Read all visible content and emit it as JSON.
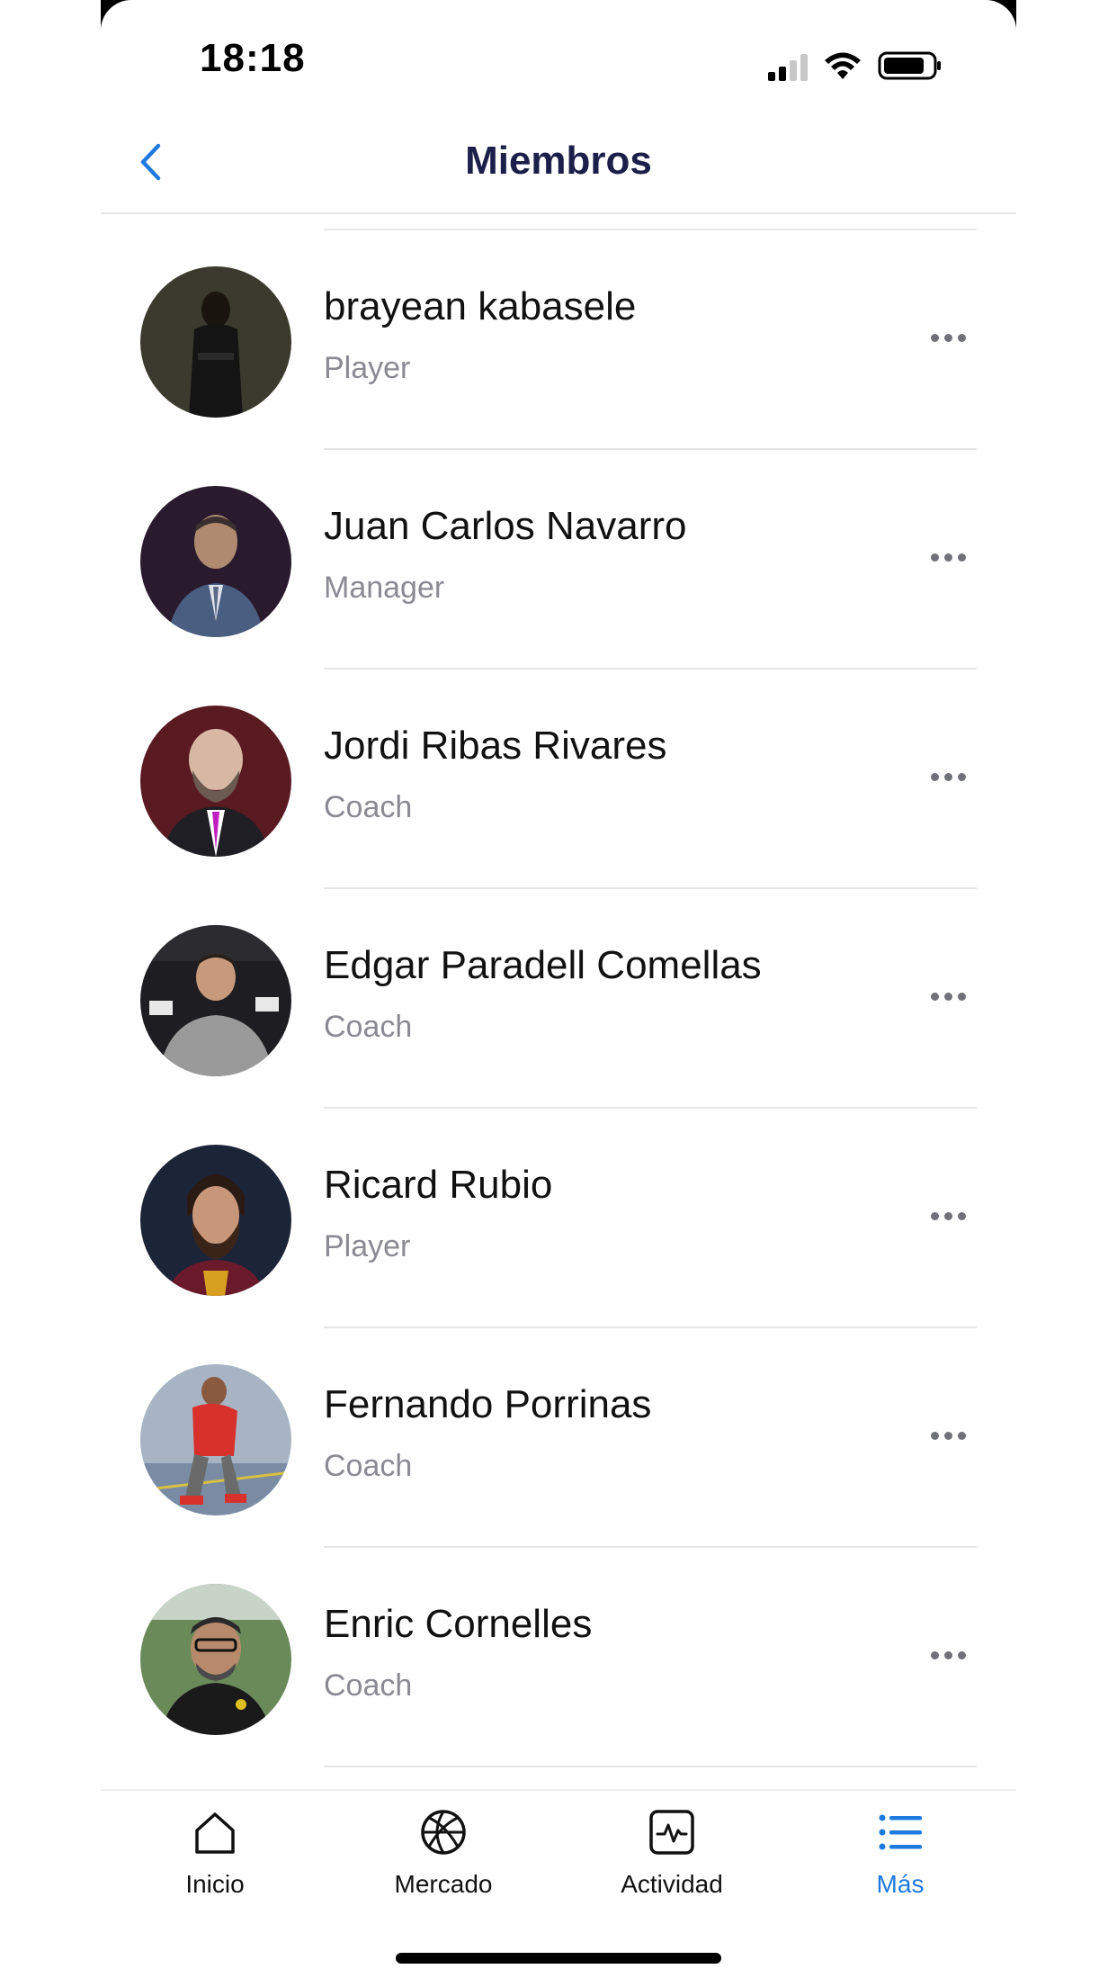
{
  "status_bar": {
    "time": "18:18",
    "signal_icon": "cellular-signal-icon",
    "wifi_icon": "wifi-icon",
    "battery_icon": "battery-icon"
  },
  "nav": {
    "title": "Miembros",
    "back_icon": "chevron-left-icon",
    "accent_color": "#1f7ae0",
    "title_color": "#1c1f4a"
  },
  "members": [
    {
      "name": "brayean kabasele",
      "role": "Player",
      "avatar_icon": "avatar"
    },
    {
      "name": "Juan Carlos Navarro",
      "role": "Manager",
      "avatar_icon": "avatar"
    },
    {
      "name": "Jordi Ribas Rivares",
      "role": "Coach",
      "avatar_icon": "avatar"
    },
    {
      "name": "Edgar Paradell Comellas",
      "role": "Coach",
      "avatar_icon": "avatar"
    },
    {
      "name": "Ricard Rubio",
      "role": "Player",
      "avatar_icon": "avatar"
    },
    {
      "name": "Fernando Porrinas",
      "role": "Coach",
      "avatar_icon": "avatar"
    },
    {
      "name": "Enric Cornelles",
      "role": "Coach",
      "avatar_icon": "avatar"
    }
  ],
  "more_icon": "ellipsis-icon",
  "tabs": [
    {
      "label": "Inicio",
      "icon": "home-icon",
      "active": false
    },
    {
      "label": "Mercado",
      "icon": "basketball-icon",
      "active": false
    },
    {
      "label": "Actividad",
      "icon": "activity-icon",
      "active": false
    },
    {
      "label": "Más",
      "icon": "list-icon",
      "active": true
    }
  ]
}
